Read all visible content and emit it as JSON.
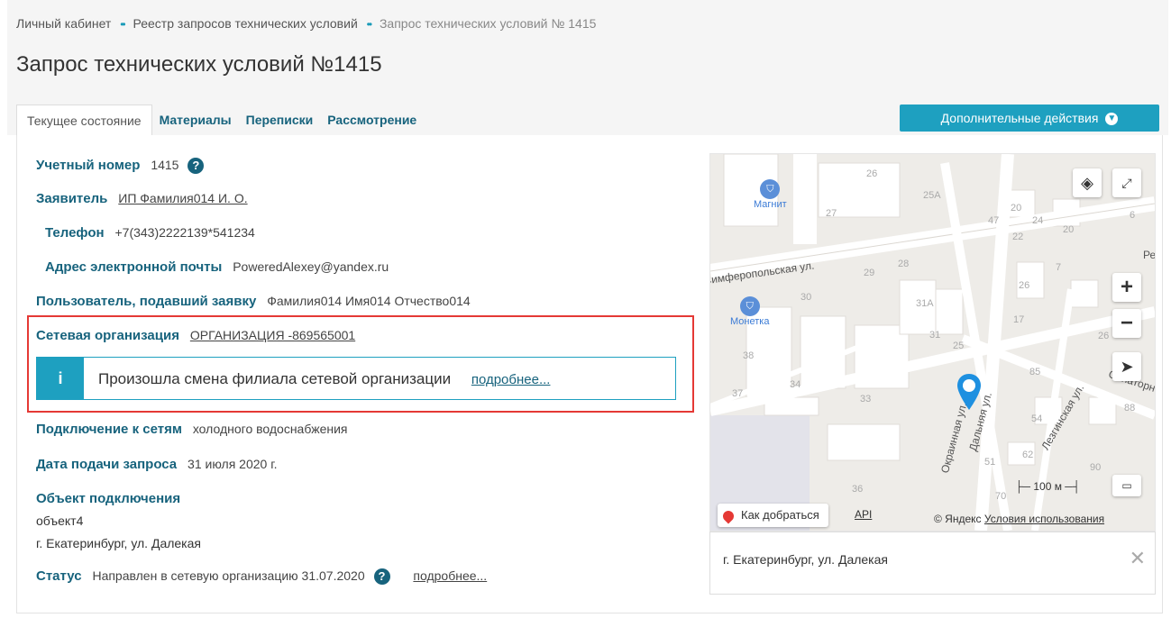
{
  "breadcrumb": {
    "items": [
      "Личный кабинет",
      "Реестр запросов технических условий"
    ],
    "current": "Запрос технических условий № 1415",
    "separator": "••"
  },
  "page_title": "Запрос технических условий №1415",
  "tabs": [
    "Текущее состояние",
    "Материалы",
    "Переписки",
    "Рассмотрение"
  ],
  "actions_button": "Дополнительные действия",
  "fields": {
    "account_label": "Учетный номер",
    "account_value": "1415",
    "applicant_label": "Заявитель",
    "applicant_value": "ИП Фамилия014 И. О.",
    "phone_label": "Телефон",
    "phone_value": "+7(343)2222139*541234",
    "email_label": "Адрес электронной почты",
    "email_value": "PoweredAlexey@yandex.ru",
    "user_label": "Пользователь, подавший заявку",
    "user_value": "Фамилия014 Имя014 Отчество014",
    "network_label": "Сетевая организация",
    "network_value": "ОРГАНИЗАЦИЯ -869565001",
    "connection_label": "Подключение к сетям",
    "connection_value": "холодного водоснабжения",
    "date_label": "Дата подачи запроса",
    "date_value": "31 июля 2020 г.",
    "object_label": "Объект подключения",
    "object_name": "объект4",
    "object_address": "г. Екатеринбург, ул. Далекая",
    "status_label": "Статус",
    "status_value": "Направлен в сетевую организацию 31.07.2020",
    "status_link": "подробнее..."
  },
  "info": {
    "icon": "i",
    "text": "Произошла смена филиала сетевой организации",
    "link": "подробнее..."
  },
  "map": {
    "route_button": "Как добраться",
    "api_link": "API",
    "copyright": "© Яндекс",
    "terms": "Условия использования",
    "scale": "100 м",
    "poi": [
      "Магнит",
      "Монетка"
    ],
    "streets": [
      "Симферопольская ул.",
      "Окраинная ул.",
      "Лезгинская ул.",
      "Санаторная ул.",
      "Дальняя ул.",
      "Режи"
    ],
    "numbers": [
      "26",
      "25А",
      "27",
      "47",
      "20",
      "24",
      "20",
      "6",
      "22",
      "29",
      "28",
      "7",
      "30",
      "31А",
      "26",
      "17",
      "26",
      "31",
      "25",
      "38",
      "34",
      "85",
      "37",
      "33",
      "54",
      "88",
      "51",
      "62",
      "90",
      "36",
      "70"
    ]
  },
  "address_panel": "г. Екатеринбург, ул. Далекая",
  "colors": {
    "accent": "#1ea0c0",
    "label": "#17637d",
    "highlight": "#e53935"
  }
}
